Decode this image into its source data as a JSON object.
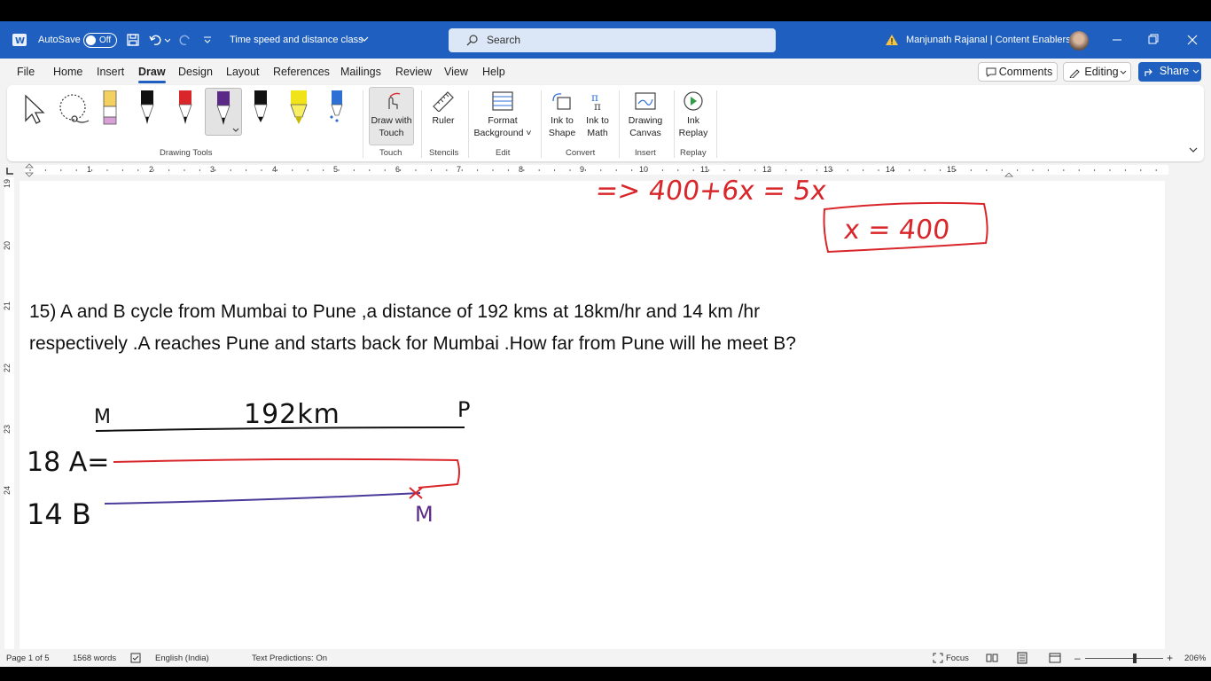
{
  "titlebar": {
    "autosave_label": "AutoSave",
    "autosave_state": "Off",
    "doc_title": "Time speed and distance class",
    "search_placeholder": "Search",
    "user_name": "Manjunath Rajanal | Content Enablers"
  },
  "tabs": [
    "File",
    "Home",
    "Insert",
    "Draw",
    "Design",
    "Layout",
    "References",
    "Mailings",
    "Review",
    "View",
    "Help"
  ],
  "active_tab": "Draw",
  "actions": {
    "comments": "Comments",
    "editing": "Editing",
    "share": "Share"
  },
  "ribbon": {
    "drawing_tools_label": "Drawing Tools",
    "draw_with_touch": [
      "Draw with",
      "Touch"
    ],
    "touch_group": "Touch",
    "ruler": "Ruler",
    "stencils_group": "Stencils",
    "format_background": [
      "Format",
      "Background"
    ],
    "edit_group": "Edit",
    "ink_to_shape": [
      "Ink to",
      "Shape"
    ],
    "ink_to_math": [
      "Ink to",
      "Math"
    ],
    "convert_group": "Convert",
    "drawing_canvas": [
      "Drawing",
      "Canvas"
    ],
    "insert_group": "Insert",
    "ink_replay": [
      "Ink",
      "Replay"
    ],
    "replay_group": "Replay",
    "pen_colors": [
      "#f4d060",
      "#111111",
      "#d9262a",
      "#5b2a86",
      "#111111",
      "#f1e31a",
      "#2e6fd6"
    ]
  },
  "ruler": {
    "numbers": [
      "1",
      "2",
      "3",
      "4",
      "5",
      "6",
      "7",
      "8",
      "9",
      "10",
      "11",
      "12",
      "13",
      "14",
      "15"
    ],
    "vertical_numbers": [
      "19",
      "20",
      "21",
      "22",
      "23",
      "24"
    ]
  },
  "document": {
    "ink_top_line": "=> 400+6x = 5x",
    "ink_boxed": "x = 400",
    "question_line1": "15) A and B cycle from Mumbai to Pune ,a distance of 192 kms at 18km/hr and 14 km /hr",
    "question_line2": "respectively .A reaches Pune and starts back for Mumbai .How far from Pune will he meet B?",
    "ink_diagram": {
      "start_label": "M",
      "distance_label": "192km",
      "end_label": "P",
      "a_label": "18 A=",
      "b_label": "14 B",
      "meet_label": "M"
    },
    "ink_colors": {
      "red": "#d9262a",
      "blue": "#4a3a9a",
      "black": "#111111"
    }
  },
  "status": {
    "page": "Page 1 of 5",
    "words": "1568 words",
    "language": "English (India)",
    "predictions": "Text Predictions: On",
    "focus": "Focus",
    "zoom": "206%"
  }
}
